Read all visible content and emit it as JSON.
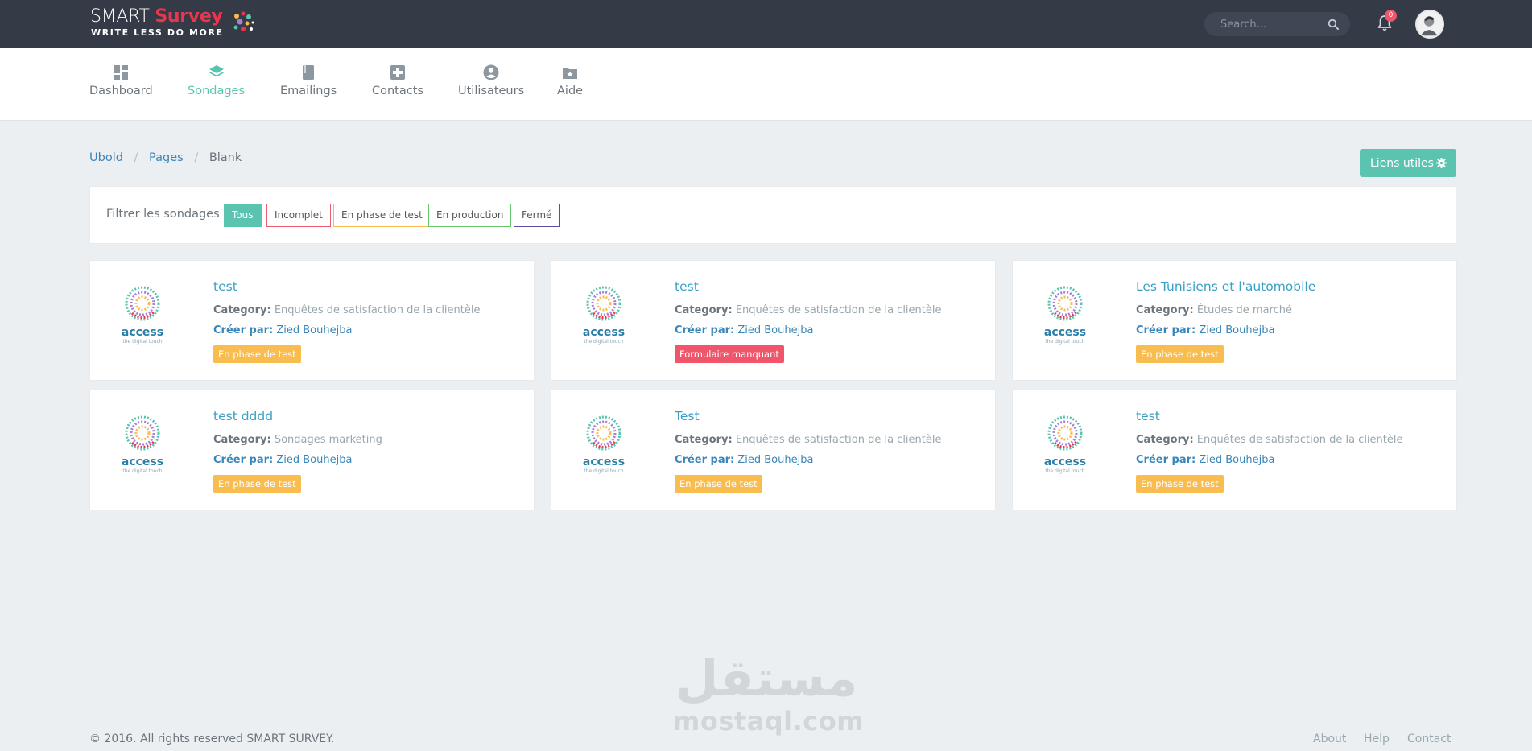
{
  "brand": {
    "name_part1": "SMART",
    "name_part2": "Survey",
    "tagline": "WRITE LESS DO MORE"
  },
  "topbar": {
    "search_placeholder": "Search...",
    "notification_count": "0"
  },
  "nav": {
    "items": [
      {
        "label": "Dashboard",
        "icon": "dashboard-icon"
      },
      {
        "label": "Sondages",
        "icon": "layers-icon",
        "active": true
      },
      {
        "label": "Emailings",
        "icon": "book-icon"
      },
      {
        "label": "Contacts",
        "icon": "contacts-icon"
      },
      {
        "label": "Utilisateurs",
        "icon": "user-circle-icon"
      },
      {
        "label": "Aide",
        "icon": "folder-star-icon"
      }
    ]
  },
  "breadcrumb": {
    "items": [
      "Ubold",
      "Pages",
      "Blank"
    ]
  },
  "liens_utiles": "Liens utiles",
  "filter": {
    "label": "Filtrer les sondages",
    "buttons": [
      "Tous",
      "Incomplet",
      "En phase de test",
      "En production",
      "Fermé"
    ]
  },
  "card_labels": {
    "category": "Category:",
    "author": "Créer par:"
  },
  "surveys": [
    {
      "title": "test",
      "category": "Enquêtes de satisfaction de la clientèle",
      "author": "Zied Bouhejba",
      "status": "En phase de test",
      "status_color": "#f9bc4f"
    },
    {
      "title": "test",
      "category": "Enquêtes de satisfaction de la clientèle",
      "author": "Zied Bouhejba",
      "status": "Formulaire manquant",
      "status_color": "#f1556c"
    },
    {
      "title": "Les Tunisiens et l'automobile",
      "category": "Études de marché",
      "author": "Zied Bouhejba",
      "status": "En phase de test",
      "status_color": "#f9bc4f"
    },
    {
      "title": "test dddd",
      "category": "Sondages marketing",
      "author": "Zied Bouhejba",
      "status": "En phase de test",
      "status_color": "#f9bc4f"
    },
    {
      "title": "Test",
      "category": "Enquêtes de satisfaction de la clientèle",
      "author": "Zied Bouhejba",
      "status": "En phase de test",
      "status_color": "#f9bc4f"
    },
    {
      "title": "test",
      "category": "Enquêtes de satisfaction de la clientèle",
      "author": "Zied Bouhejba",
      "status": "En phase de test",
      "status_color": "#f9bc4f"
    }
  ],
  "card_logo": {
    "word": "access",
    "tagline": "the digital touch"
  },
  "watermark": {
    "arabic": "مستقل",
    "latin": "mostaql.com"
  },
  "footer": {
    "copyright": "© 2016. All rights reserved SMART SURVEY.",
    "links": [
      "About",
      "Help",
      "Contact"
    ]
  },
  "colors": {
    "topbar": "#343a46",
    "accent": "#5ac4b1",
    "link": "#3a9fc5",
    "badge_test": "#f9bc4f",
    "badge_missing": "#f1556c"
  }
}
